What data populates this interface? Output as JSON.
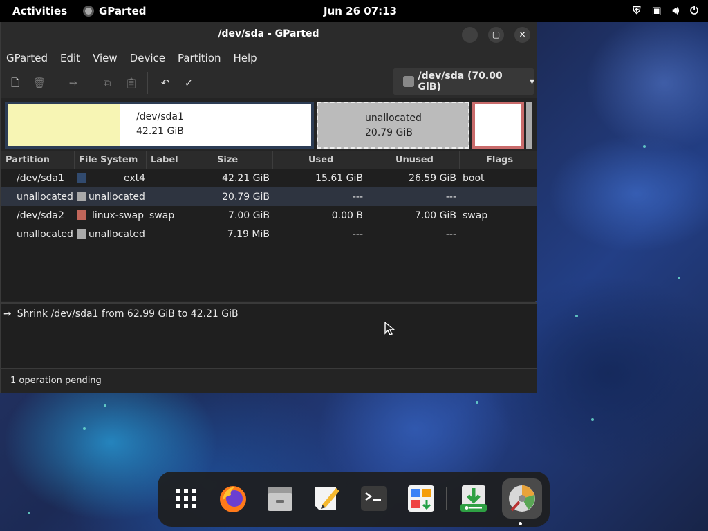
{
  "topbar": {
    "activities": "Activities",
    "app_name": "GParted",
    "clock": "Jun 26  07:13",
    "tray_icons": [
      "shield-icon",
      "network-icon",
      "volume-icon",
      "power-icon"
    ]
  },
  "window": {
    "title": "/dev/sda - GParted",
    "controls": [
      "minimize-icon",
      "maximize-icon",
      "close-icon"
    ]
  },
  "menu": [
    "GParted",
    "Edit",
    "View",
    "Device",
    "Partition",
    "Help"
  ],
  "toolbar": {
    "buttons": [
      "new-icon",
      "delete-icon",
      "resize-move-icon",
      "copy-icon",
      "paste-icon",
      "undo-icon",
      "apply-icon"
    ],
    "device": "/dev/sda (70.00 GiB)"
  },
  "partition_map": {
    "seg1_name": "/dev/sda1",
    "seg1_size": "42.21 GiB",
    "seg2_name": "unallocated",
    "seg2_size": "20.79 GiB"
  },
  "table": {
    "headers": [
      "Partition",
      "File System",
      "Label",
      "Size",
      "Used",
      "Unused",
      "Flags"
    ],
    "rows": [
      {
        "partition": "/dev/sda1",
        "fs": "ext4",
        "fs_color": "#314a6e",
        "label": "",
        "size": "42.21 GiB",
        "used": "15.61 GiB",
        "unused": "26.59 GiB",
        "flags": "boot"
      },
      {
        "partition": "unallocated",
        "fs": "unallocated",
        "fs_color": "#a9a9a9",
        "label": "",
        "size": "20.79 GiB",
        "used": "---",
        "unused": "---",
        "flags": ""
      },
      {
        "partition": "/dev/sda2",
        "fs": "linux-swap",
        "fs_color": "#c1665a",
        "label": "swap",
        "size": "7.00 GiB",
        "used": "0.00 B",
        "unused": "7.00 GiB",
        "flags": "swap"
      },
      {
        "partition": "unallocated",
        "fs": "unallocated",
        "fs_color": "#a9a9a9",
        "label": "",
        "size": "7.19 MiB",
        "used": "---",
        "unused": "---",
        "flags": ""
      }
    ]
  },
  "operations": [
    "Shrink /dev/sda1 from 62.99 GiB to 42.21 GiB"
  ],
  "status": "1 operation pending",
  "dock": [
    "app-grid-icon",
    "firefox-icon",
    "files-icon",
    "text-editor-icon",
    "terminal-icon",
    "software-icon",
    "installer-icon",
    "gparted-icon"
  ]
}
